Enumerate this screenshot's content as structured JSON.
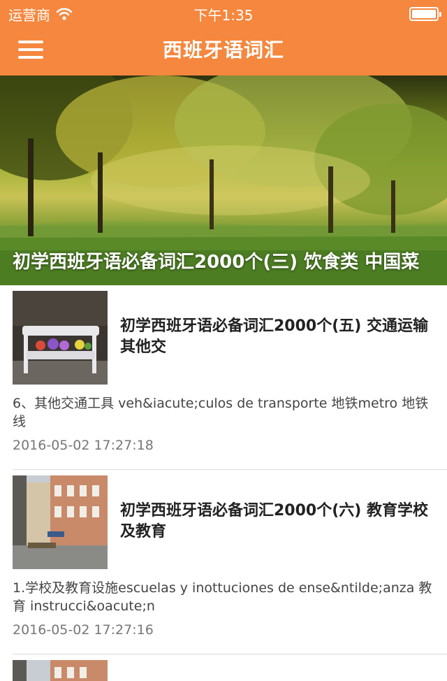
{
  "status_bar": {
    "carrier": "运营商",
    "time": "下午1:35"
  },
  "nav": {
    "title": "西班牙语词汇",
    "menu_icon": "menu-icon"
  },
  "hero": {
    "title": "初学西班牙语必备词汇2000个(三) 饮食类 中国菜"
  },
  "articles": [
    {
      "title": "初学西班牙语必备词汇2000个(五) 交通运输 其他交",
      "summary": "6、其他交通工具 veh&iacute;culos de transporte 地铁metro 地铁线",
      "time": "2016-05-02 17:27:18"
    },
    {
      "title": "初学西班牙语必备词汇2000个(六) 教育学校及教育",
      "summary": "1.学校及教育设施escuelas y inottuciones de ense&ntilde;anza 教育 instrucci&oacute;n",
      "time": "2016-05-02 17:27:16"
    }
  ],
  "colors": {
    "accent": "#f5873e"
  }
}
